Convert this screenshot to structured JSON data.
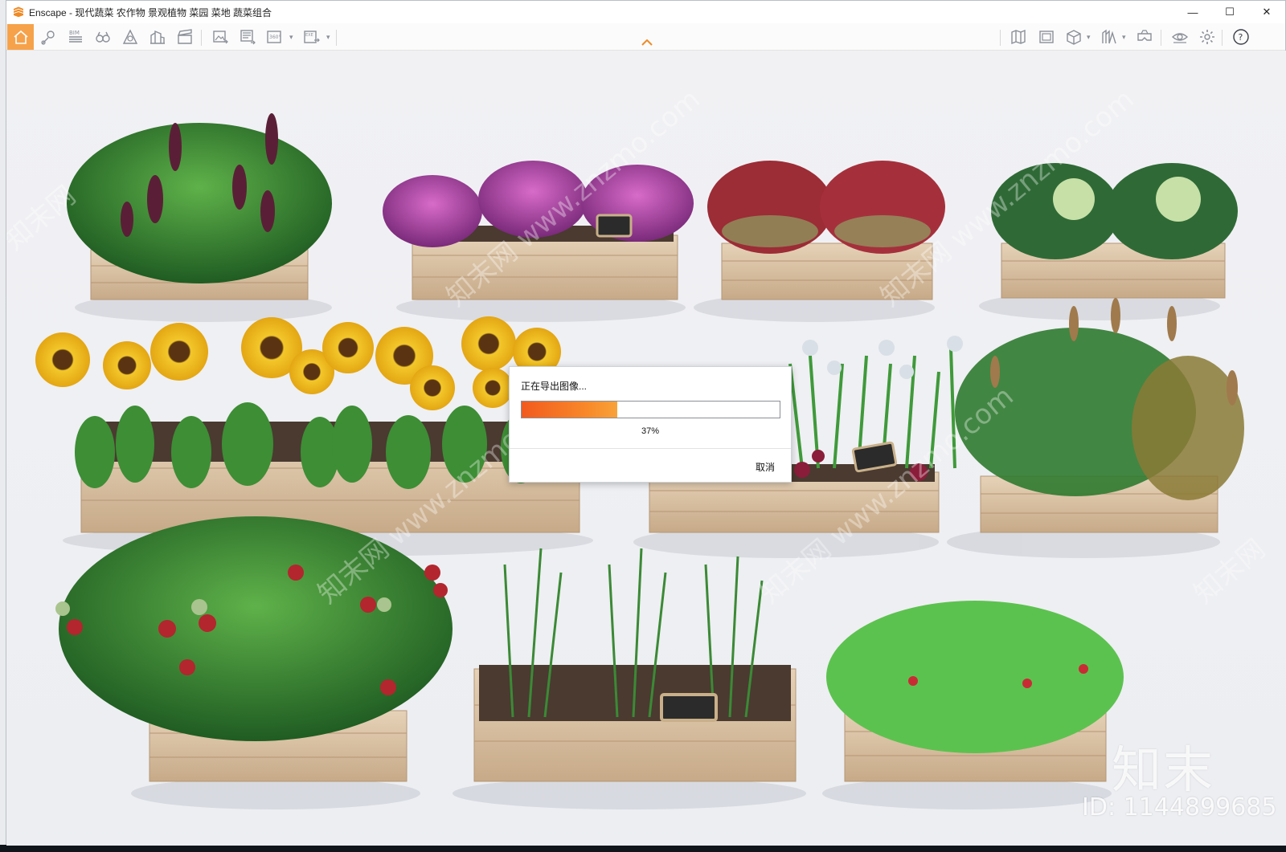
{
  "window": {
    "title": "Enscape - 现代蔬菜 农作物 景观植物 菜园 菜地 蔬菜组合",
    "controls": {
      "minimize": "—",
      "maximize": "☐",
      "close": "✕"
    }
  },
  "toolbar": {
    "left_icons": [
      "home-icon",
      "location-icon",
      "bim-icon",
      "binoculars-icon",
      "atmosphere-icon",
      "buildings-icon",
      "clapper-icon",
      "export-image-icon",
      "batch-render-icon",
      "panorama-360-icon",
      "exe-export-icon"
    ],
    "right_icons": [
      "map-icon",
      "capture-icon",
      "cube-icon",
      "asset-library-icon",
      "vr-headset-icon",
      "visibility-icon",
      "settings-icon",
      "help-icon"
    ],
    "labels": {
      "bim": "BIM",
      "pano": "360°",
      "exe": "EXE",
      "help": "?"
    }
  },
  "viewport": {
    "watermark_logo": "知末",
    "watermark_id": "ID: 1144899685"
  },
  "dialog": {
    "title": "正在导出图像...",
    "progress": 0.37,
    "progress_label": "37%",
    "cancel_label": "取消"
  },
  "colors": {
    "accent": "#f6a24a",
    "progress_start": "#f25a1e",
    "progress_end": "#f8a23a",
    "wood": "#d9c0a2",
    "soil": "#4a3a30"
  }
}
